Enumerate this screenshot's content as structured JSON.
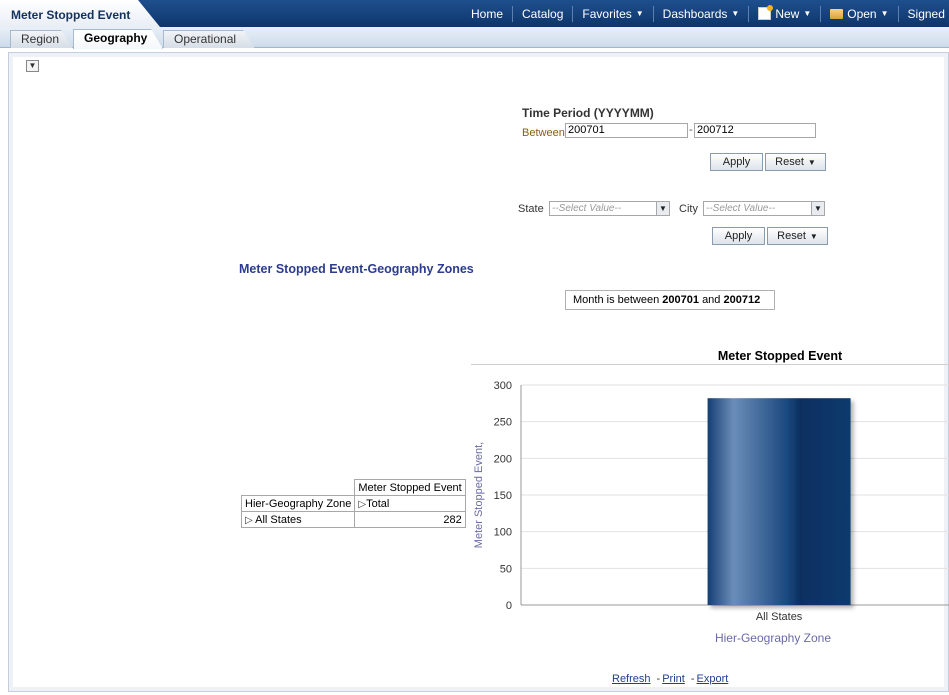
{
  "header": {
    "page_title": "Meter Stopped Event",
    "nav": {
      "home": "Home",
      "catalog": "Catalog",
      "favorites": "Favorites",
      "dashboards": "Dashboards",
      "new": "New",
      "open": "Open",
      "signed_in": "Signed In As"
    }
  },
  "tabs": {
    "region": "Region",
    "geography": "Geography",
    "operational": "Operational",
    "active": "Geography"
  },
  "prompts": {
    "time_period_title": "Time Period (YYYYMM)",
    "between_label": "Between",
    "start_value": "200701",
    "separator": "-",
    "end_value": "200712",
    "apply_label": "Apply",
    "reset_label": "Reset",
    "state_label": "State",
    "state_placeholder": "--Select Value--",
    "city_label": "City",
    "city_placeholder": "--Select Value--"
  },
  "section": {
    "title": "Meter Stopped Event-Geography Zones",
    "filter_prefix": "Month is between",
    "filter_start": "200701",
    "filter_and": "and",
    "filter_end": "200712"
  },
  "pivot": {
    "measure_header": "Meter Stopped Event",
    "row_header": "Hier-Geography Zone",
    "col_member": "Total",
    "row_member": "All States",
    "value": "282"
  },
  "chart_data": {
    "type": "bar",
    "title": "Meter Stopped Event",
    "categories": [
      "All States"
    ],
    "values": [
      282
    ],
    "xlabel": "Hier-Geography Zone",
    "ylabel": "Meter Stopped Event,",
    "ylim": [
      0,
      300
    ],
    "yticks": [
      0,
      50,
      100,
      150,
      200,
      250,
      300
    ],
    "grid": true,
    "bar_color": "#0e3a6e"
  },
  "footer": {
    "refresh": "Refresh",
    "print": "Print",
    "export": "Export",
    "separator": "-"
  }
}
